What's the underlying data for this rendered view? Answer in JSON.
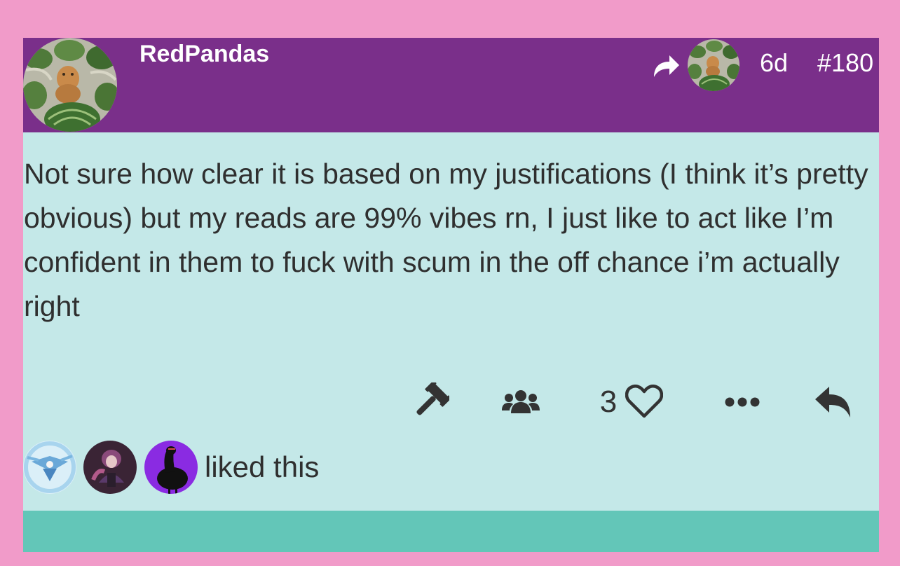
{
  "colors": {
    "page_background": "#f19bc9",
    "header_background": "#7a2f8a",
    "body_background": "#c4e8e8",
    "footer_background": "#63c6b8",
    "text": "#2f2f2f",
    "icon": "#333333"
  },
  "post": {
    "author": "RedPandas",
    "time": "6d",
    "number": "#180",
    "body": "Not sure how clear it is based on my justifications (I think it’s pretty obvious) but my reads are 99% vibes rn, I just like to act like I’m confident in them to fuck with scum in the off chance i’m actually right",
    "like_count": "3",
    "liked_text": "liked this"
  },
  "icons": {
    "share": "share-arrow-icon",
    "vote": "gavel-icon",
    "players": "users-icon",
    "like": "heart-icon",
    "more": "ellipsis-icon",
    "reply": "reply-arrow-icon"
  }
}
